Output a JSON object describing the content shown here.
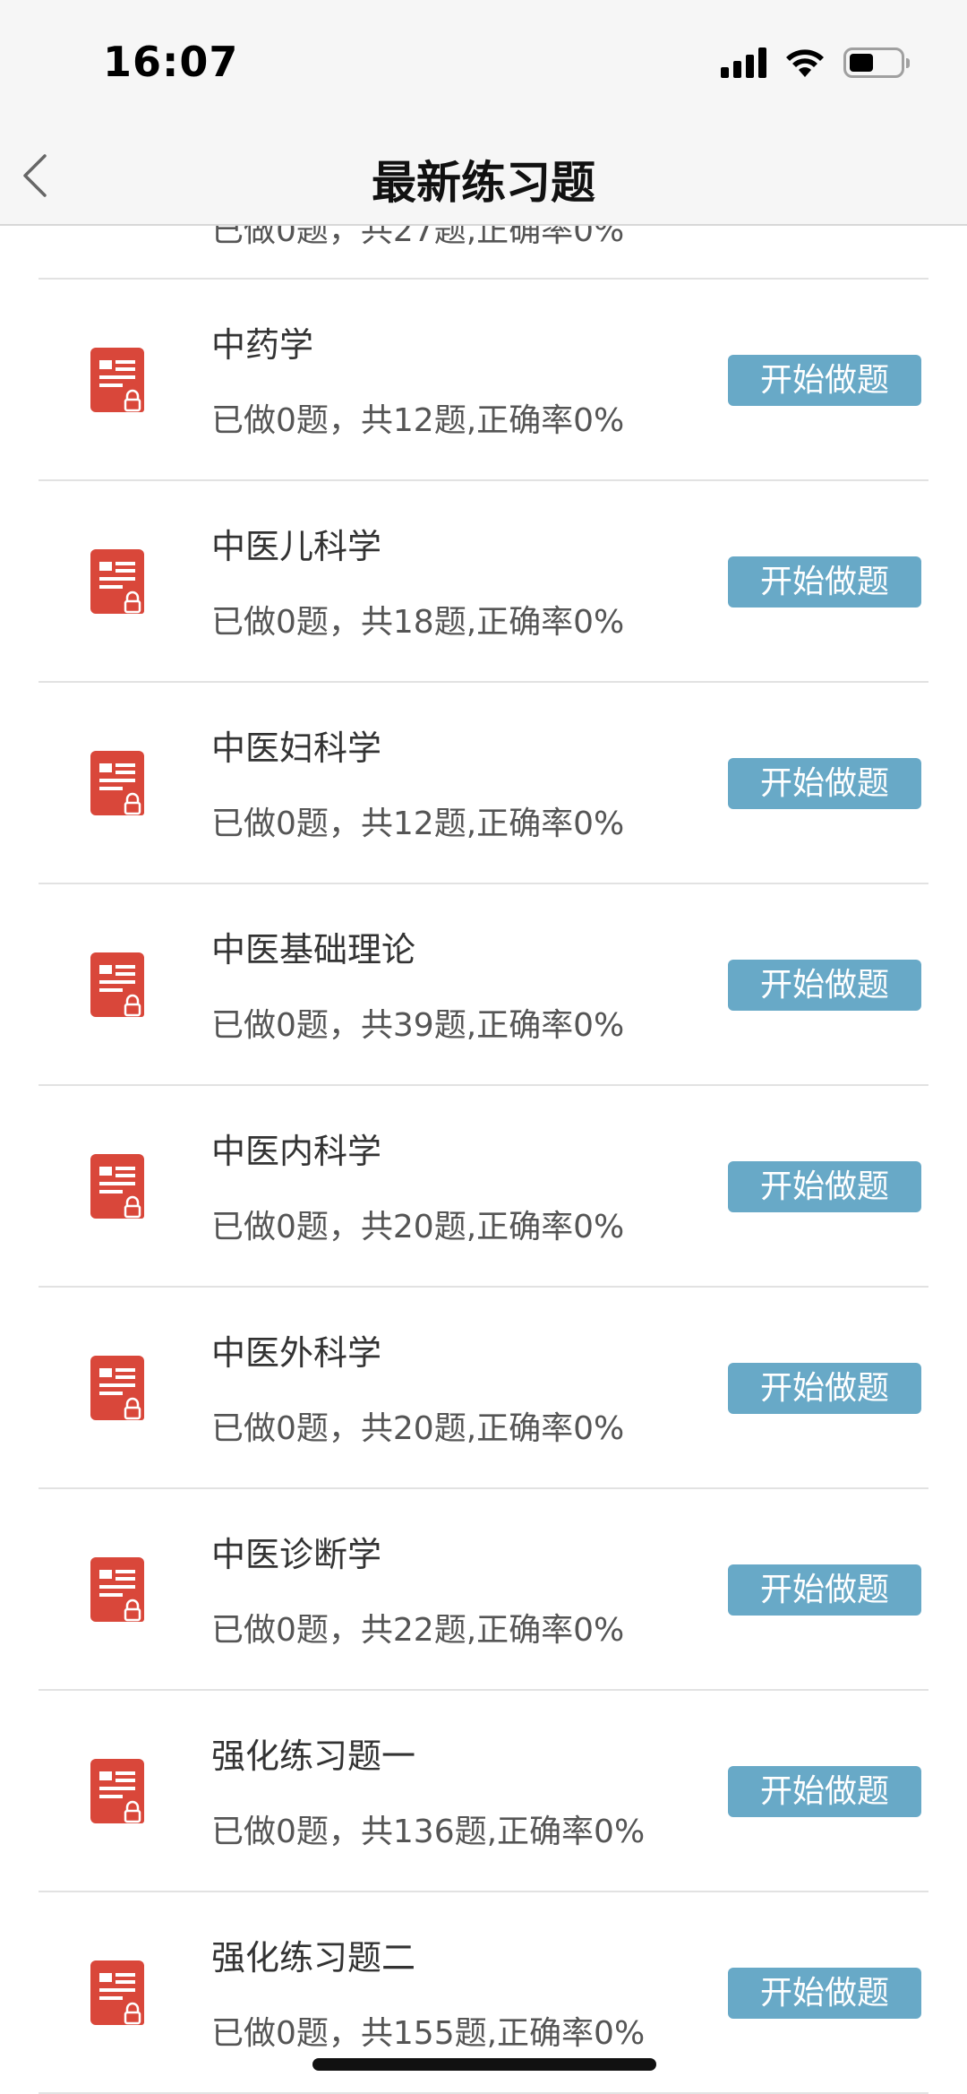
{
  "status_bar": {
    "time": "16:07"
  },
  "nav": {
    "title": "最新练习题"
  },
  "partial_row": {
    "subtitle": "已做0题，共27题,正确率0%"
  },
  "rows": [
    {
      "title": "中药学",
      "subtitle": "已做0题，共12题,正确率0%",
      "button": "开始做题"
    },
    {
      "title": "中医儿科学",
      "subtitle": "已做0题，共18题,正确率0%",
      "button": "开始做题"
    },
    {
      "title": "中医妇科学",
      "subtitle": "已做0题，共12题,正确率0%",
      "button": "开始做题"
    },
    {
      "title": "中医基础理论",
      "subtitle": "已做0题，共39题,正确率0%",
      "button": "开始做题"
    },
    {
      "title": "中医内科学",
      "subtitle": "已做0题，共20题,正确率0%",
      "button": "开始做题"
    },
    {
      "title": "中医外科学",
      "subtitle": "已做0题，共20题,正确率0%",
      "button": "开始做题"
    },
    {
      "title": "中医诊断学",
      "subtitle": "已做0题，共22题,正确率0%",
      "button": "开始做题"
    },
    {
      "title": "强化练习题一",
      "subtitle": "已做0题，共136题,正确率0%",
      "button": "开始做题"
    },
    {
      "title": "强化练习题二",
      "subtitle": "已做0题，共155题,正确率0%",
      "button": "开始做题"
    }
  ],
  "colors": {
    "accent_button": "#68a9c7",
    "icon_red": "#d9473a"
  }
}
